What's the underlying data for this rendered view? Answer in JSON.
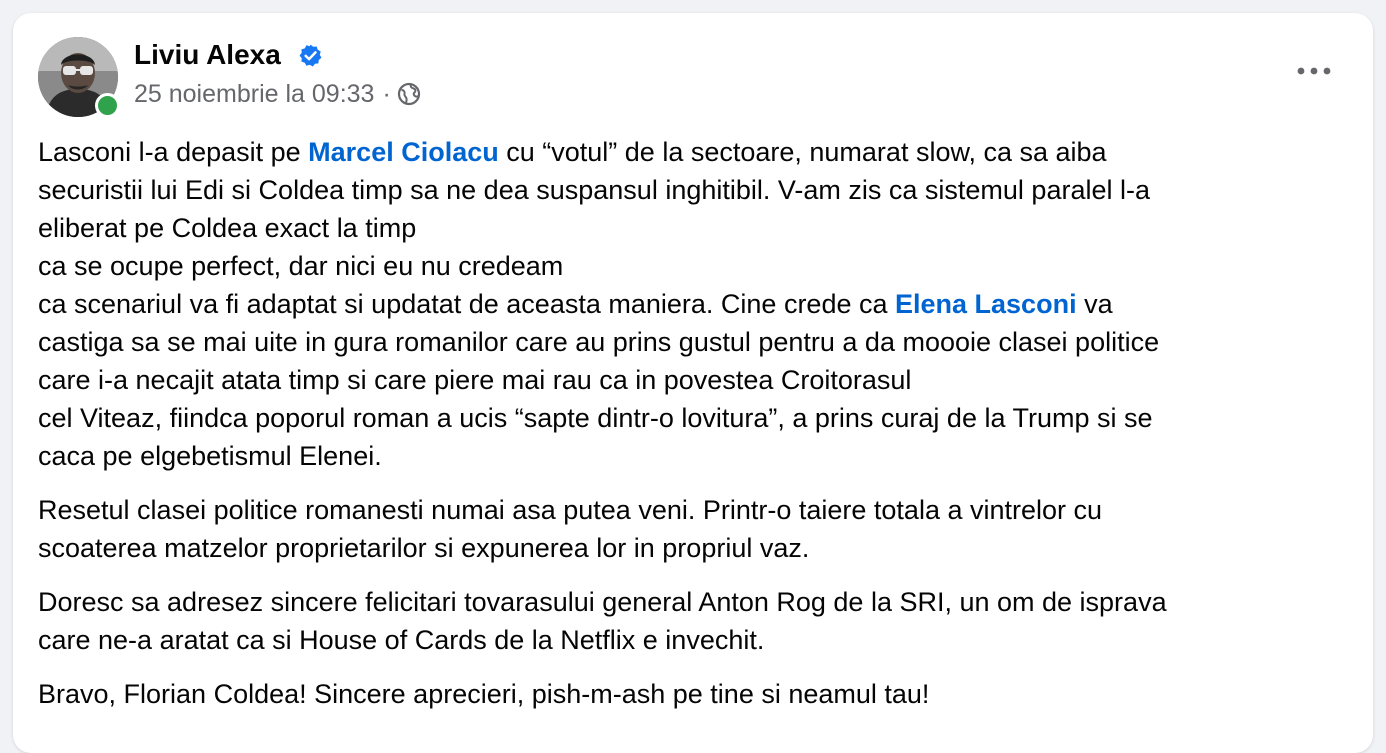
{
  "post": {
    "author": {
      "name": "Liviu Alexa",
      "verified_icon": "verified-badge-icon",
      "online": true
    },
    "meta": {
      "date": "25 noiembrie la 09:33",
      "separator": "·",
      "audience_icon": "globe-icon"
    },
    "more_icon": "more-options-icon",
    "colors": {
      "mention": "#0064d1",
      "verified": "#1877f2",
      "online": "#31a24c",
      "text": "#050505",
      "meta": "#65676b"
    },
    "paragraphs": [
      {
        "lines": [
          {
            "parts": [
              {
                "text": "Lasconi l-a depasit pe "
              },
              {
                "text": "Marcel Ciolacu",
                "mention": true
              },
              {
                "text": " cu “votul” de la sectoare, numarat slow, ca sa aiba"
              }
            ]
          },
          {
            "parts": [
              {
                "text": "securistii lui Edi si Coldea timp sa ne dea suspansul inghitibil. V-am zis ca sistemul paralel l-a"
              }
            ]
          },
          {
            "parts": [
              {
                "text": "eliberat pe Coldea exact la timp"
              }
            ]
          },
          {
            "parts": [
              {
                "text": "ca se ocupe perfect, dar nici eu nu credeam"
              }
            ]
          },
          {
            "parts": [
              {
                "text": "ca scenariul va fi adaptat si updatat de aceasta maniera. Cine crede ca "
              },
              {
                "text": "Elena Lasconi",
                "mention": true
              },
              {
                "text": " va"
              }
            ]
          },
          {
            "parts": [
              {
                "text": "castiga sa se mai uite in gura romanilor care au prins gustul pentru a da moooie clasei politice"
              }
            ]
          },
          {
            "parts": [
              {
                "text": "care i-a necajit atata timp si care piere mai rau ca in povestea Croitorasul"
              }
            ]
          },
          {
            "parts": [
              {
                "text": "cel Viteaz, fiindca poporul roman a ucis “sapte dintr-o lovitura”, a prins curaj de la Trump si se"
              }
            ]
          },
          {
            "parts": [
              {
                "text": "caca pe elgebetismul Elenei."
              }
            ]
          }
        ]
      },
      {
        "lines": [
          {
            "parts": [
              {
                "text": "Resetul clasei politice romanesti numai asa putea veni. Printr-o taiere totala a vintrelor cu"
              }
            ]
          },
          {
            "parts": [
              {
                "text": "scoaterea matzelor proprietarilor si expunerea lor in propriul vaz."
              }
            ]
          }
        ]
      },
      {
        "lines": [
          {
            "parts": [
              {
                "text": "Doresc sa adresez sincere felicitari tovarasului general Anton Rog de la SRI, un om de isprava"
              }
            ]
          },
          {
            "parts": [
              {
                "text": "care ne-a aratat ca si House of Cards de la Netflix e invechit."
              }
            ]
          }
        ]
      },
      {
        "lines": [
          {
            "parts": [
              {
                "text": "Bravo, Florian Coldea! Sincere aprecieri, pish-m-ash pe tine si neamul tau!"
              }
            ]
          }
        ]
      }
    ]
  }
}
